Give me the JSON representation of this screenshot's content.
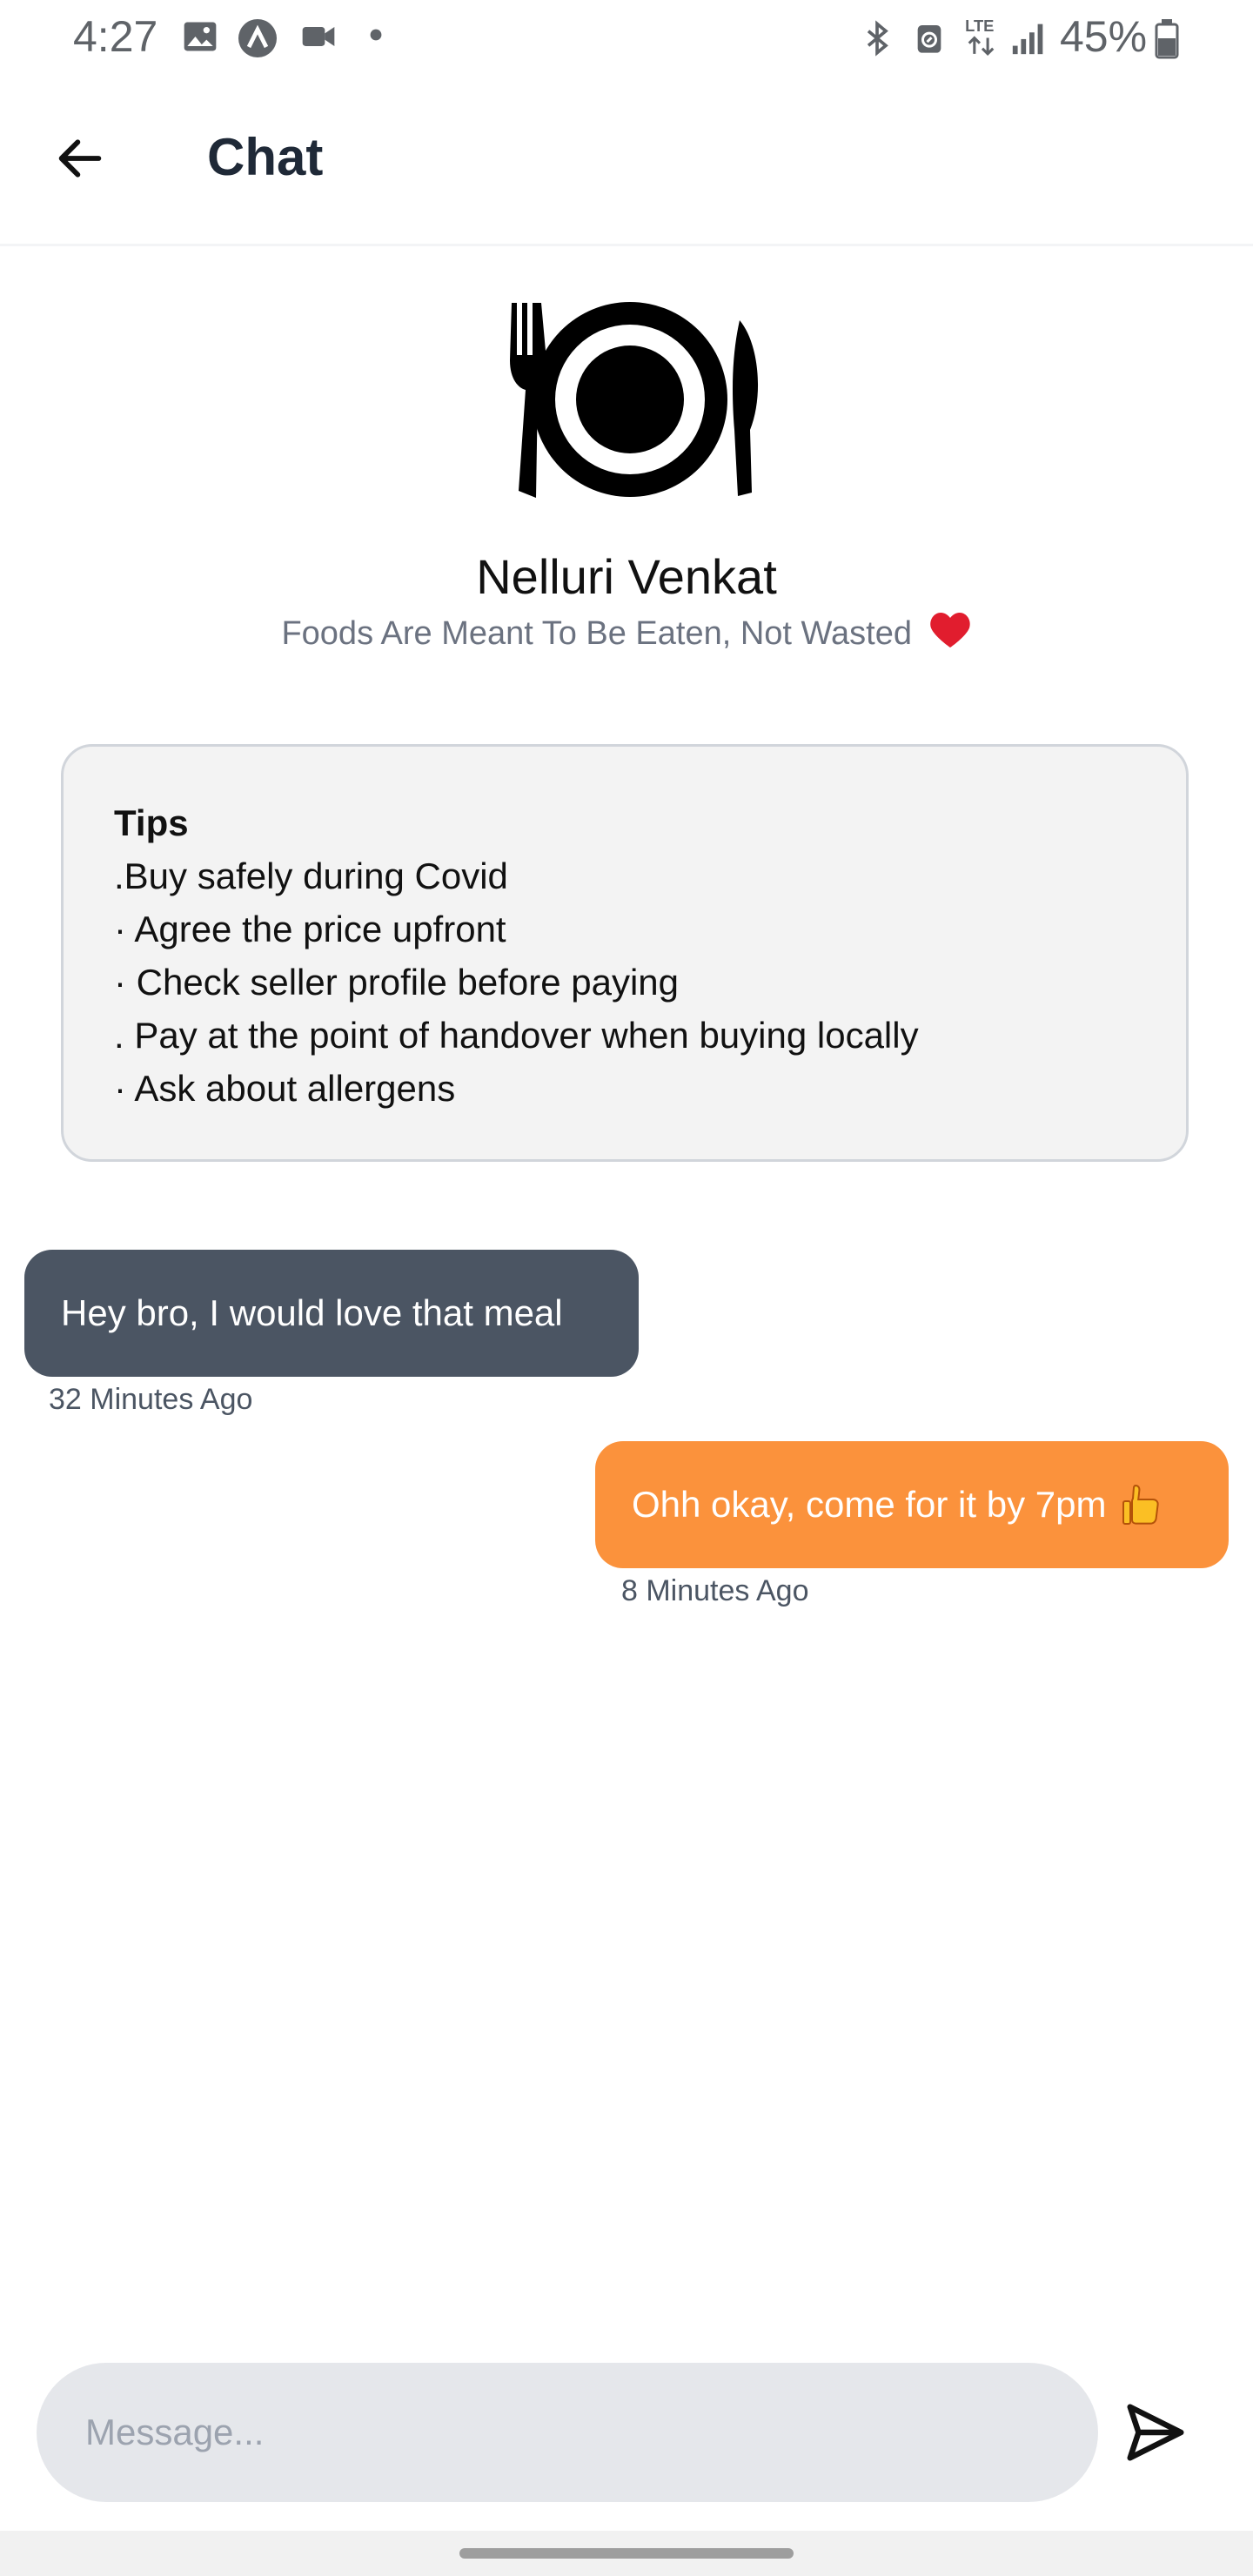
{
  "status_bar": {
    "time": "4:27",
    "battery_percent": "45%",
    "network": "LTE",
    "icons": [
      "image-icon",
      "app-notification-icon",
      "video-icon",
      "dot-icon",
      "bluetooth-icon",
      "nfc-icon",
      "lte-icon",
      "signal-icon",
      "battery-icon"
    ]
  },
  "app_bar": {
    "title": "Chat",
    "back_icon": "arrow-left-icon"
  },
  "profile": {
    "logo_icon": "plate-fork-knife-icon",
    "name": "Nelluri Venkat",
    "tagline": "Foods Are Meant To Be Eaten, Not Wasted",
    "tagline_emoji": "heart-icon"
  },
  "tips": {
    "title": "Tips",
    "lines": [
      ".Buy safely during Covid",
      "· Agree the price upfront",
      "· Check seller profile before paying",
      ". Pay at the point of handover when buying locally",
      "· Ask about allergens"
    ]
  },
  "messages": [
    {
      "direction": "received",
      "text": "Hey bro, I would love that meal",
      "time": "32 Minutes Ago"
    },
    {
      "direction": "sent",
      "text": "Ohh okay, come for it by 7pm",
      "emoji": "thumbs-up-icon",
      "time": "8 Minutes Ago"
    }
  ],
  "composer": {
    "placeholder": "Message...",
    "value": "",
    "send_icon": "send-icon"
  },
  "colors": {
    "received_bubble": "#4b5563",
    "sent_bubble": "#fb923c",
    "input_background": "#e5e7eb",
    "tips_background": "#f3f3f3"
  }
}
